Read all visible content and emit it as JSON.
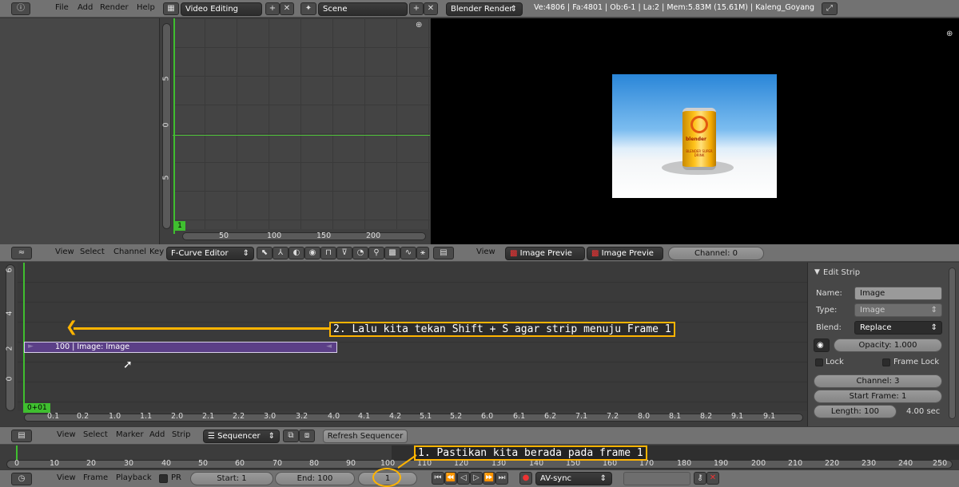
{
  "info_header": {
    "menu": [
      "File",
      "Add",
      "Render",
      "Help"
    ],
    "layout": "Video Editing",
    "scene": "Scene",
    "engine": "Blender Render",
    "stats": "Ve:4806 | Fa:4801 | Ob:6-1 | La:2 | Mem:5.83M (15.61M) | Kaleng_Goyang"
  },
  "graph": {
    "frame_badge": "1",
    "y_ticks": [
      "5",
      "0",
      "5"
    ],
    "x_ticks": [
      "50",
      "100",
      "150",
      "200"
    ]
  },
  "graph_header": {
    "menu": [
      "View",
      "Select",
      "Channel",
      "Key"
    ],
    "mode": "F-Curve Editor",
    "trailing": "N"
  },
  "preview_header": {
    "menu": "View",
    "display1": "Image Previe",
    "display2": "Image Previe",
    "channel": "Channel: 0"
  },
  "preview": {
    "can_label_1": "blender",
    "can_label_2": "BLENDER SUPER DRINK"
  },
  "sequencer": {
    "y_ticks": [
      "6",
      "4",
      "2",
      "0"
    ],
    "x_ticks": [
      "0.1",
      "0.2",
      "1.0",
      "1.1",
      "2.0",
      "2.1",
      "2.2",
      "3.0",
      "3.2",
      "4.0",
      "4.1",
      "4.2",
      "5.1",
      "5.2",
      "6.0",
      "6.1",
      "6.2",
      "7.1",
      "7.2",
      "8.0",
      "8.1",
      "8.2",
      "9.1",
      "9.1"
    ],
    "strip_label": "100 | Image: Image",
    "frame_badge": "0+01"
  },
  "edit_strip": {
    "title": "Edit Strip",
    "name_label": "Name:",
    "name_value": "Image",
    "type_label": "Type:",
    "type_value": "Image",
    "blend_label": "Blend:",
    "blend_value": "Replace",
    "opacity": "Opacity: 1.000",
    "lock": "Lock",
    "frame_lock": "Frame Lock",
    "channel": "Channel: 3",
    "start_frame": "Start Frame: 1",
    "length": "Length: 100",
    "seconds": "4.00 sec"
  },
  "seq_header": {
    "menu": [
      "View",
      "Select",
      "Marker",
      "Add",
      "Strip"
    ],
    "mode": "Sequencer",
    "refresh": "Refresh Sequencer"
  },
  "timeline": {
    "ticks": [
      "0",
      "10",
      "20",
      "30",
      "40",
      "50",
      "60",
      "70",
      "80",
      "90",
      "100",
      "110",
      "120",
      "130",
      "140",
      "150",
      "160",
      "170",
      "180",
      "190",
      "200",
      "210",
      "220",
      "230",
      "240",
      "250"
    ]
  },
  "bottom_header": {
    "menu": [
      "View",
      "Frame",
      "Playback"
    ],
    "pr": "PR",
    "start": "Start: 1",
    "end": "End: 100",
    "current": "1",
    "sync": "AV-sync"
  },
  "annotations": {
    "step2": "2. Lalu kita tekan Shift + S agar strip menuju Frame 1",
    "step1": "1. Pastikan kita berada pada frame 1"
  },
  "colors": {
    "accent_annotation": "#ffb400",
    "strip": "#5b3f87",
    "playhead": "#3fbf2f"
  }
}
